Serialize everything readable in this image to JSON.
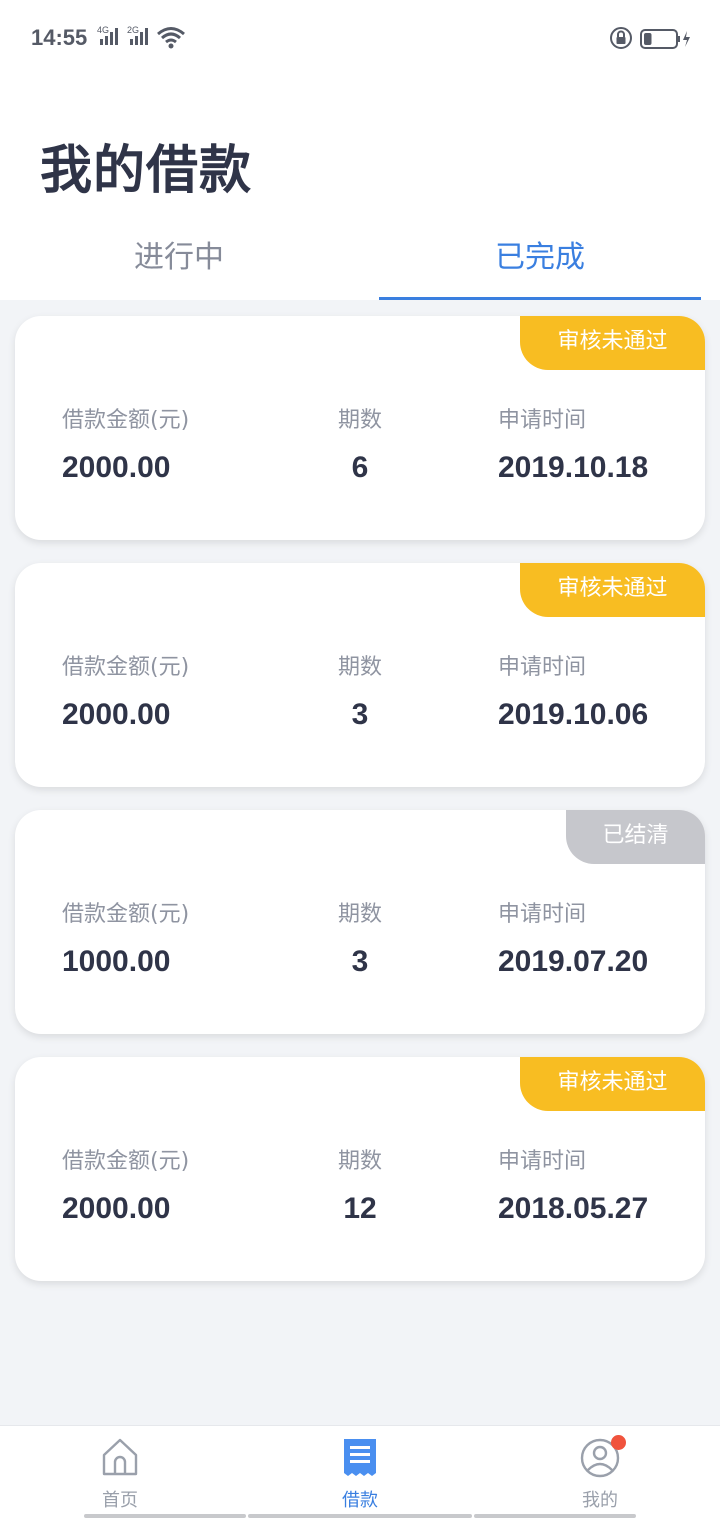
{
  "status_bar": {
    "time": "14:55",
    "network_1": "4G",
    "network_2": "2G",
    "battery_level": 0.25
  },
  "page": {
    "title": "我的借款"
  },
  "tabs": [
    {
      "label": "进行中",
      "active": false
    },
    {
      "label": "已完成",
      "active": true
    }
  ],
  "loans": [
    {
      "status": "审核未通过",
      "status_type": "rejected",
      "amount_label": "借款金额(元)",
      "amount": "2000.00",
      "periods_label": "期数",
      "periods": "6",
      "date_label": "申请时间",
      "date": "2019.10.18"
    },
    {
      "status": "审核未通过",
      "status_type": "rejected",
      "amount_label": "借款金额(元)",
      "amount": "2000.00",
      "periods_label": "期数",
      "periods": "3",
      "date_label": "申请时间",
      "date": "2019.10.06"
    },
    {
      "status": "已结清",
      "status_type": "settled",
      "amount_label": "借款金额(元)",
      "amount": "1000.00",
      "periods_label": "期数",
      "periods": "3",
      "date_label": "申请时间",
      "date": "2019.07.20"
    },
    {
      "status": "审核未通过",
      "status_type": "rejected",
      "amount_label": "借款金额(元)",
      "amount": "2000.00",
      "periods_label": "期数",
      "periods": "12",
      "date_label": "申请时间",
      "date": "2018.05.27"
    }
  ],
  "bottom_nav": [
    {
      "label": "首页",
      "icon": "home-icon",
      "active": false
    },
    {
      "label": "借款",
      "icon": "bill-icon",
      "active": true
    },
    {
      "label": "我的",
      "icon": "user-icon",
      "active": false,
      "has_dot": true
    }
  ],
  "colors": {
    "accent": "#3a7fe0",
    "rejected_badge": "#f8bd22",
    "settled_badge": "#c6c7cc",
    "notification_dot": "#f0533d"
  }
}
